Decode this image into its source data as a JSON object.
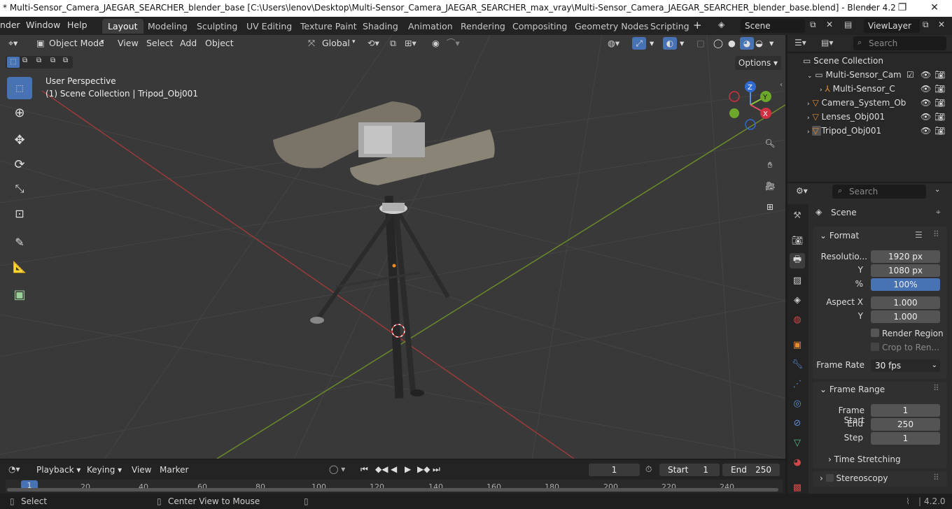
{
  "window": {
    "title": "* Multi-Sensor_Camera_JAEGAR_SEARCHER_blender_base [C:\\Users\\lenov\\Desktop\\Multi-Sensor_Camera_JAEGAR_SEARCHER_max_vray\\Multi-Sensor_Camera_JAEGAR_SEARCHER_blender_base.blend] - Blender 4.2",
    "minimize": "—",
    "maximize": "❐",
    "close": "✕"
  },
  "menu": [
    "nder",
    "Window",
    "Help"
  ],
  "workspaces": [
    "Layout",
    "Modeling",
    "Sculpting",
    "UV Editing",
    "Texture Paint",
    "Shading",
    "Animation",
    "Rendering",
    "Compositing",
    "Geometry Nodes",
    "Scripting"
  ],
  "add_workspace": "+",
  "scene": {
    "name": "Scene",
    "view_layer": "ViewLayer"
  },
  "viewport": {
    "mode": "Object Mode",
    "menus": [
      "View",
      "Select",
      "Add",
      "Object"
    ],
    "orientation": "Global",
    "options_label": "Options",
    "perspective_label": "User Perspective",
    "context_label": "(1) Scene Collection | Tripod_Obj001",
    "gizmo": {
      "z": "Z",
      "y": "Y",
      "x": "X"
    }
  },
  "outliner": {
    "search_placeholder": "Search",
    "root": "Scene Collection",
    "items": [
      {
        "label": "Multi-Sensor_Cam",
        "indent": 1
      },
      {
        "label": "Multi-Sensor_C",
        "indent": 2
      },
      {
        "label": "Camera_System_Ob",
        "indent": 1
      },
      {
        "label": "Lenses_Obj001",
        "indent": 1
      },
      {
        "label": "Tripod_Obj001",
        "indent": 1
      }
    ]
  },
  "properties": {
    "search_placeholder": "Search",
    "context": "Scene",
    "format": {
      "title": "Format",
      "resolution_x_label": "Resolutio...",
      "resolution_x": "1920 px",
      "resolution_y_label": "Y",
      "resolution_y": "1080 px",
      "percent_label": "%",
      "percent": "100%",
      "aspect_x_label": "Aspect X",
      "aspect_x": "1.000",
      "aspect_y_label": "Y",
      "aspect_y": "1.000",
      "render_region": "Render Region",
      "crop": "Crop to Ren...",
      "frame_rate_label": "Frame Rate",
      "frame_rate": "30 fps"
    },
    "frame_range": {
      "title": "Frame Range",
      "start_label": "Frame Start",
      "start": "1",
      "end_label": "End",
      "end": "250",
      "step_label": "Step",
      "step": "1"
    },
    "time_stretching": "Time Stretching",
    "stereoscopy": "Stereoscopy"
  },
  "timeline": {
    "menus": [
      "Playback",
      "Keying",
      "View",
      "Marker"
    ],
    "current_frame": "1",
    "start_label": "Start",
    "start": "1",
    "end_label": "End",
    "end": "250",
    "ruler": [
      "1",
      "20",
      "40",
      "60",
      "80",
      "100",
      "120",
      "140",
      "160",
      "180",
      "200",
      "220",
      "240"
    ]
  },
  "status": {
    "select": "Select",
    "center": "Center View to Mouse",
    "version": "4.2.0"
  },
  "colors": {
    "accent": "#4772b3",
    "grid_x": "#9a3a3a",
    "grid_y": "#6a8a2a"
  }
}
